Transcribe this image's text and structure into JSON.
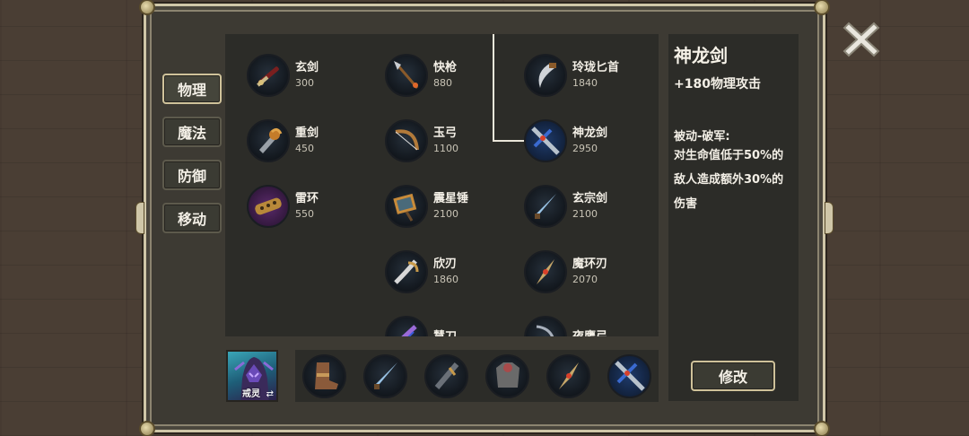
{
  "categories": [
    {
      "label": "物理",
      "active": true
    },
    {
      "label": "魔法",
      "active": false
    },
    {
      "label": "防御",
      "active": false
    },
    {
      "label": "移动",
      "active": false
    }
  ],
  "items": [
    {
      "name": "玄剑",
      "price": "300",
      "icon": "sword-icon"
    },
    {
      "name": "重剑",
      "price": "450",
      "icon": "heavy-sword-icon"
    },
    {
      "name": "雷环",
      "price": "550",
      "icon": "thunder-ring-icon"
    },
    {
      "name": "快枪",
      "price": "880",
      "icon": "spear-icon"
    },
    {
      "name": "玉弓",
      "price": "1100",
      "icon": "bow-icon"
    },
    {
      "name": "震星锤",
      "price": "2100",
      "icon": "hammer-icon"
    },
    {
      "name": "欣刃",
      "price": "1860",
      "icon": "curved-blade-icon"
    },
    {
      "name": "慧刀",
      "price": "",
      "icon": "purple-blade-icon"
    },
    {
      "name": "玲珑匕首",
      "price": "1840",
      "icon": "dagger-icon"
    },
    {
      "name": "神龙剑",
      "price": "2950",
      "icon": "dragon-sword-icon"
    },
    {
      "name": "玄宗剑",
      "price": "2100",
      "icon": "blade-icon"
    },
    {
      "name": "魔环刃",
      "price": "2070",
      "icon": "ring-blade-icon"
    },
    {
      "name": "夜鹰弓",
      "price": "",
      "icon": "night-bow-icon"
    }
  ],
  "detail": {
    "name": "神龙剑",
    "stat": "+180物理攻击",
    "passive_title": "被动-破军:",
    "desc_lines": [
      "对生命值低于50%的",
      "敌人造成额外30%的",
      "伤害"
    ]
  },
  "modify_label": "修改",
  "hero": {
    "name": "戒灵",
    "swap_symbol": "⇄"
  },
  "equipped": [
    "boots-icon",
    "blade-icon",
    "dark-sword-icon",
    "armor-icon",
    "ring-blade-icon",
    "dragon-sword-icon"
  ],
  "colors": {
    "accent_border": "#cfc29a",
    "panel": "#2c2c28",
    "frame": "#cfc6a8"
  }
}
